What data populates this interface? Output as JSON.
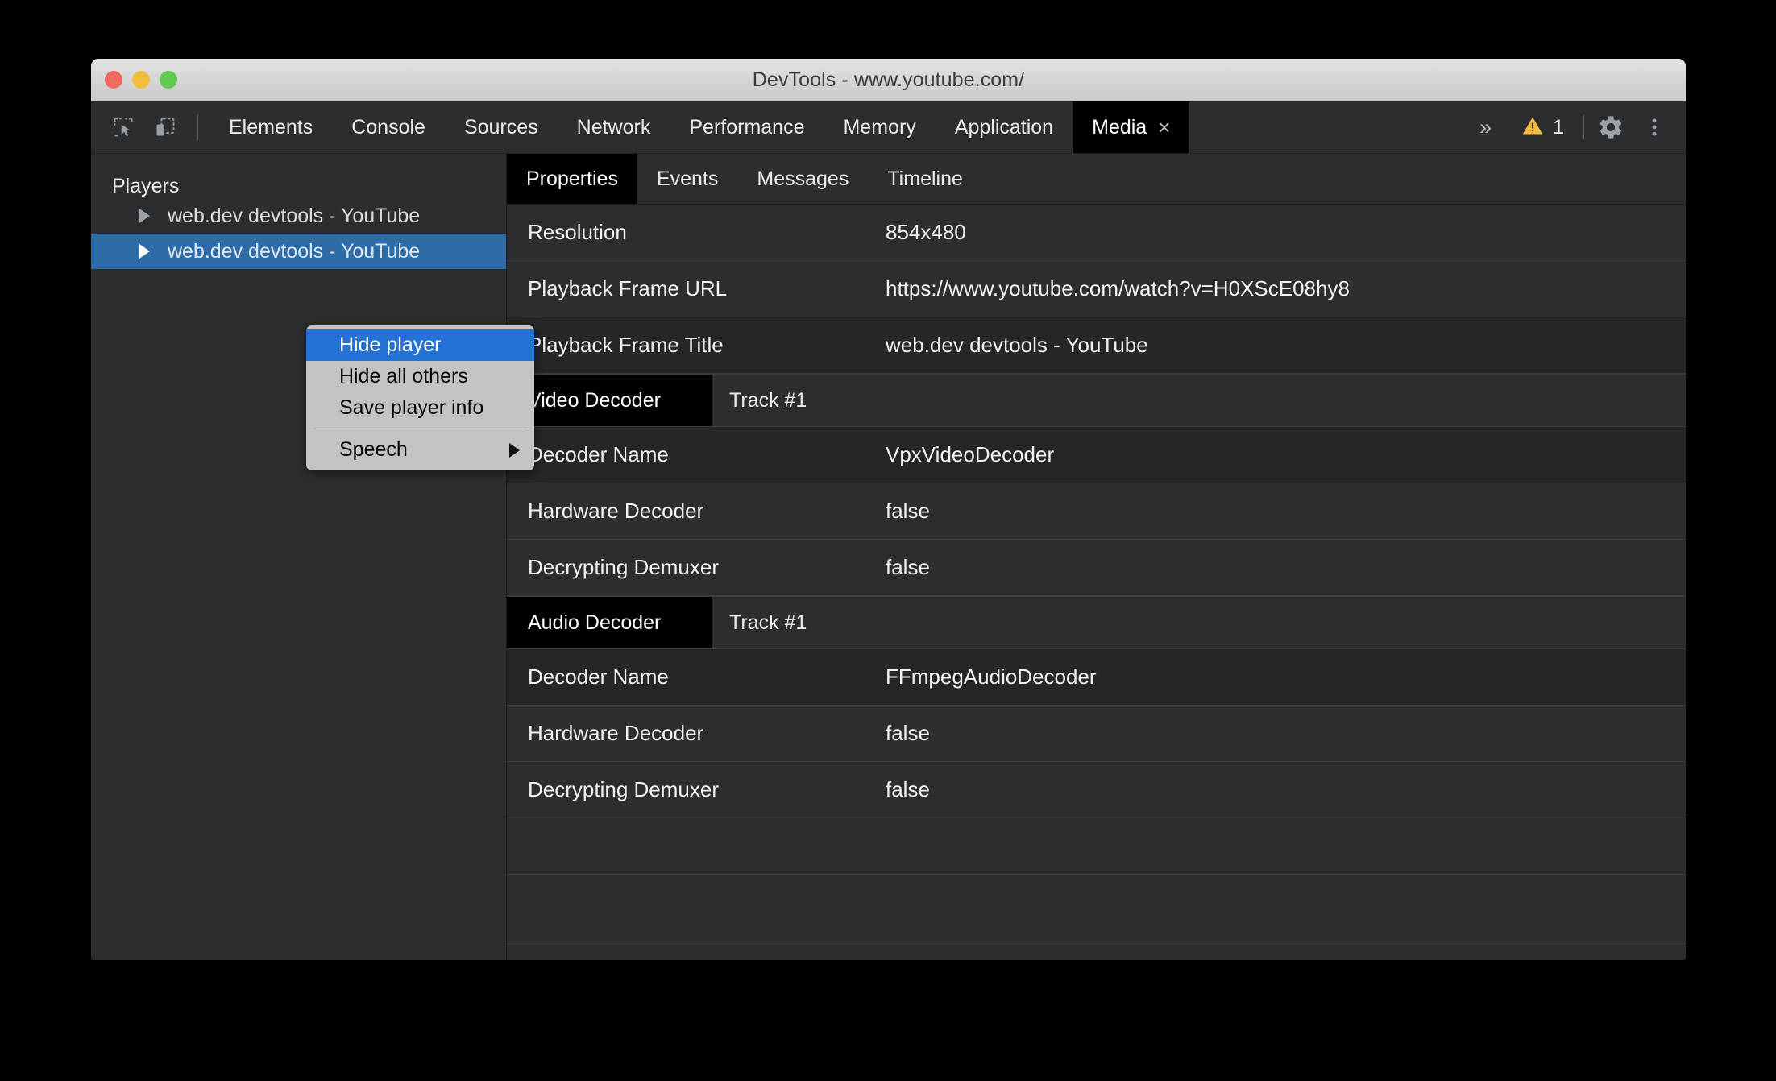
{
  "window": {
    "title": "DevTools - www.youtube.com/",
    "traffic_lights": [
      "close",
      "minimize",
      "zoom"
    ]
  },
  "toolbar": {
    "icons": [
      {
        "name": "inspect-element-icon"
      },
      {
        "name": "device-toolbar-icon"
      }
    ],
    "tabs": [
      {
        "label": "Elements",
        "active": false
      },
      {
        "label": "Console",
        "active": false
      },
      {
        "label": "Sources",
        "active": false
      },
      {
        "label": "Network",
        "active": false
      },
      {
        "label": "Performance",
        "active": false
      },
      {
        "label": "Memory",
        "active": false
      },
      {
        "label": "Application",
        "active": false
      },
      {
        "label": "Media",
        "active": true,
        "closable": true
      }
    ],
    "close_glyph": "×",
    "overflow_glyph": "»",
    "warning_count": "1",
    "settings_icon": "gear-icon",
    "more_icon": "three-dot-menu-icon",
    "warning_color": "#f5bb3d"
  },
  "sidebar": {
    "heading": "Players",
    "players": [
      {
        "label": "web.dev devtools - YouTube",
        "selected": false
      },
      {
        "label": "web.dev devtools - YouTube",
        "selected": true
      }
    ]
  },
  "context_menu": {
    "items": [
      {
        "label": "Hide player",
        "highlighted": true,
        "submenu": false
      },
      {
        "label": "Hide all others",
        "highlighted": false,
        "submenu": false
      },
      {
        "label": "Save player info",
        "highlighted": false,
        "submenu": false
      }
    ],
    "after_separator": [
      {
        "label": "Speech",
        "highlighted": false,
        "submenu": true
      }
    ],
    "highlight_color": "#2472d6"
  },
  "panel": {
    "tabs": [
      {
        "label": "Properties",
        "active": true
      },
      {
        "label": "Events",
        "active": false
      },
      {
        "label": "Messages",
        "active": false
      },
      {
        "label": "Timeline",
        "active": false
      }
    ],
    "properties": [
      {
        "key": "Resolution",
        "value": "854x480"
      },
      {
        "key": "Playback Frame URL",
        "value": "https://www.youtube.com/watch?v=H0XScE08hy8"
      },
      {
        "key": "Playback Frame Title",
        "value": "web.dev devtools - YouTube"
      }
    ],
    "video_decoder": {
      "section": "Video Decoder",
      "track": "Track #1",
      "rows": [
        {
          "key": "Decoder Name",
          "value": "VpxVideoDecoder"
        },
        {
          "key": "Hardware Decoder",
          "value": "false"
        },
        {
          "key": "Decrypting Demuxer",
          "value": "false"
        }
      ]
    },
    "audio_decoder": {
      "section": "Audio Decoder",
      "track": "Track #1",
      "rows": [
        {
          "key": "Decoder Name",
          "value": "FFmpegAudioDecoder"
        },
        {
          "key": "Hardware Decoder",
          "value": "false"
        },
        {
          "key": "Decrypting Demuxer",
          "value": "false"
        }
      ]
    },
    "empty_rows": 2
  }
}
